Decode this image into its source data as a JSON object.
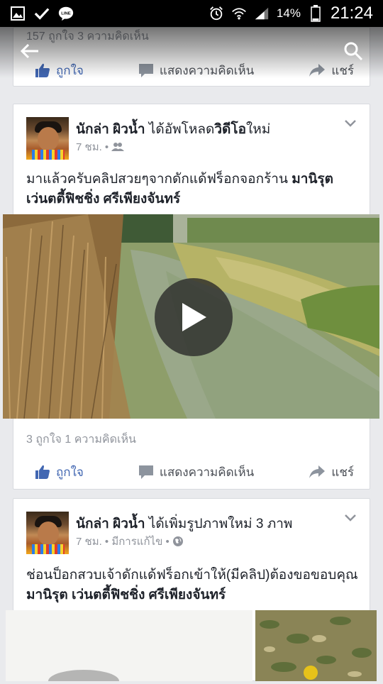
{
  "status_bar": {
    "battery": "14%",
    "time": "21:24",
    "icons": [
      "gallery-icon",
      "check-icon",
      "line-icon",
      "alarm-icon",
      "wifi-icon",
      "signal-icon",
      "battery-icon"
    ]
  },
  "top_nav": {
    "back_icon": "back-arrow-icon",
    "search_icon": "search-icon"
  },
  "card1": {
    "counts": "157 ถูกใจ   3 ความคิดเห็น",
    "like": "ถูกใจ",
    "comment": "แสดงความคิดเห็น",
    "share": "แชร์"
  },
  "card2": {
    "author": "นักล่า ผิวน้ำ",
    "action_prefix": " ได้อัพโหลด",
    "action_bold": "วิดีโอ",
    "action_suffix": "ใหม่",
    "time": "7 ชม. •",
    "text_plain": "มาแล้วครับคลิปสวยๆจากดักแด้ฟร็อกจอกร้าน ",
    "text_bold": "มานิรุต เว่นตตี้ฟิชชิ่ง ศรีเพียงจันทร์",
    "counts": "3 ถูกใจ   1 ความคิดเห็น",
    "like": "ถูกใจ",
    "comment": "แสดงความคิดเห็น",
    "share": "แชร์"
  },
  "card3": {
    "author": "นักล่า ผิวน้ำ",
    "action": " ได้เพิ่มรูปภาพใหม่ 3 ภาพ",
    "time": "7 ชม. • มีการแก้ไข •",
    "text_plain": "ช่อนป็อกสวบเจ้าดักแด้ฟร็อกเข้าให้(มีคลิป)ต้องขอขอบคุณ ",
    "text_bold": "มานิรุต เว่นตตี้ฟิชชิ่ง ศรีเพียงจันทร์"
  },
  "colors": {
    "facebook_blue": "#4267b2",
    "background": "#e9eaed",
    "muted": "#90949c"
  }
}
